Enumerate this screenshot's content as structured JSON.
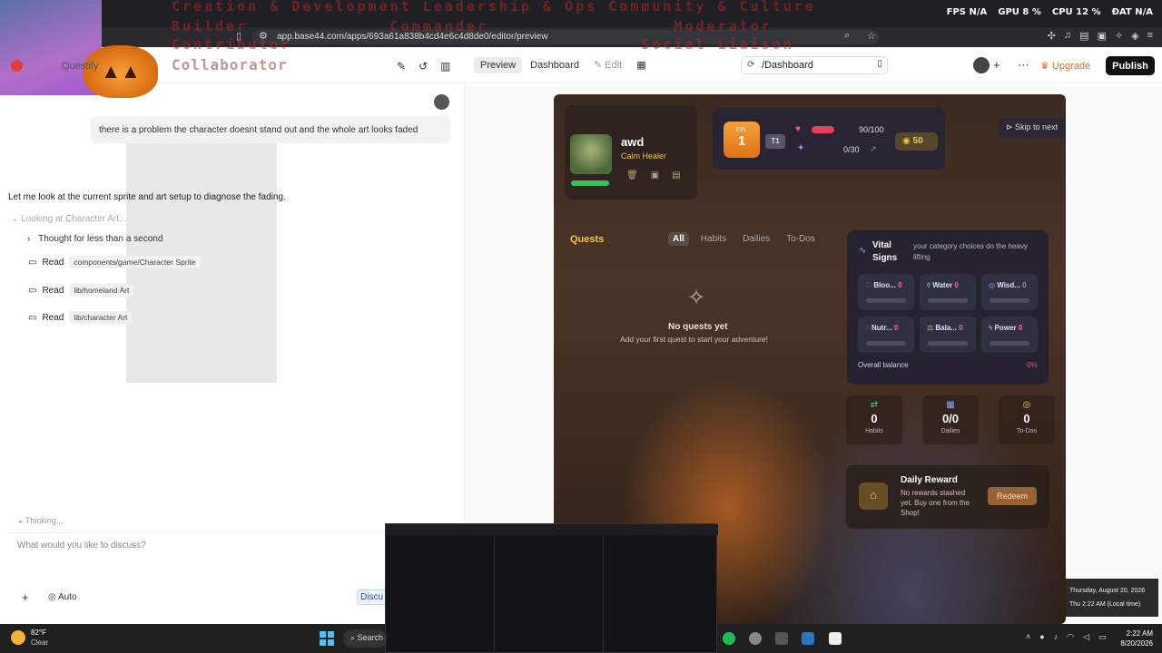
{
  "overlay": {
    "line1": "Creation & Development Leadership & Ops Community & Culture",
    "line2": "Builder             Commander                 Moderator",
    "line3": "Contributor                                Social Liaison",
    "collaborator": "Collaborator"
  },
  "hud": {
    "fps_label": "FPS",
    "fps": "N/A",
    "gpu_label": "GPU",
    "gpu": "8 %",
    "cpu_label": "CPU",
    "cpu": "12 %",
    "dat_label": "ĐAT",
    "dat": "N/A"
  },
  "browser": {
    "url": "app.base44.com/apps/693a61a838b4cd4e6c4d8de0/editor/preview"
  },
  "app": {
    "name": "Questify",
    "tabs": {
      "preview": "Preview",
      "dashboard": "Dashboard",
      "edit": "Edit"
    },
    "path": "/Dashboard",
    "upgrade": "Upgrade",
    "publish": "Publish"
  },
  "chat": {
    "user_message": "there is a problem the character doesnt stand out and the whole art looks faded",
    "assistant_message": "Let me look at the current sprite and art setup to diagnose the fading.",
    "looking": "Looking at Character Art...",
    "thought": "Thought for less than a second",
    "reads": [
      {
        "verb": "Read",
        "file": "components/game/Character Sprite"
      },
      {
        "verb": "Read",
        "file": "lib/homeland Art"
      },
      {
        "verb": "Read",
        "file": "lib/character Art"
      }
    ],
    "thinking": "Thinking...",
    "placeholder": "What would you like to discuss?",
    "mode": "Auto",
    "discuss": "Discu"
  },
  "game": {
    "character": {
      "name": "awd",
      "class": "Calm Healer"
    },
    "level": {
      "label": "LVL",
      "value": "1"
    },
    "tier": "T1",
    "hp": "90/100",
    "xp": "0/30",
    "gold": "50",
    "skip": "Skip to next",
    "quests": {
      "title": "Quests",
      "tabs": [
        "All",
        "Habits",
        "Dailies",
        "To-Dos"
      ],
      "empty_title": "No quests yet",
      "empty_sub": "Add your first quest to start your adventure!"
    },
    "vital": {
      "title": "Vital Signs",
      "subtitle": "your category choices do the heavy lifting",
      "cards": [
        {
          "label": "Bloo...",
          "value": "0",
          "icon": "heart-icon",
          "color": "#ff6b8a"
        },
        {
          "label": "Water",
          "value": "0",
          "icon": "drop-icon",
          "color": "#5ac8fa"
        },
        {
          "label": "Wisd...",
          "value": "0",
          "icon": "brain-icon",
          "color": "#b48cff"
        },
        {
          "label": "Nutr...",
          "value": "0",
          "icon": "apple-icon",
          "color": "#5ad17a"
        },
        {
          "label": "Bala...",
          "value": "0",
          "icon": "scale-icon",
          "color": "#f2c744"
        },
        {
          "label": "Power",
          "value": "0",
          "icon": "bolt-icon",
          "color": "#ff7ab6"
        }
      ],
      "overall_label": "Overall balance",
      "overall_value": "0%"
    },
    "counters": [
      {
        "value": "0",
        "label": "Habits",
        "icon": "repeat-icon"
      },
      {
        "value": "0/0",
        "label": "Dailies",
        "icon": "calendar-icon"
      },
      {
        "value": "0",
        "label": "To-Dos",
        "icon": "target-icon"
      }
    ],
    "reward": {
      "title": "Daily Reward",
      "subtitle": "No rewards stashed yet. Buy one from the Shop!",
      "button": "Redeem"
    }
  },
  "tooltip": {
    "date": "Thursday, August 20, 2026",
    "time": "Thu 2:22 AM (Local time)"
  },
  "taskbar": {
    "temp": "82°F",
    "condition": "Clear",
    "search": "Search",
    "clock_time": "2:22 AM",
    "clock_date": "8/20/2026"
  }
}
